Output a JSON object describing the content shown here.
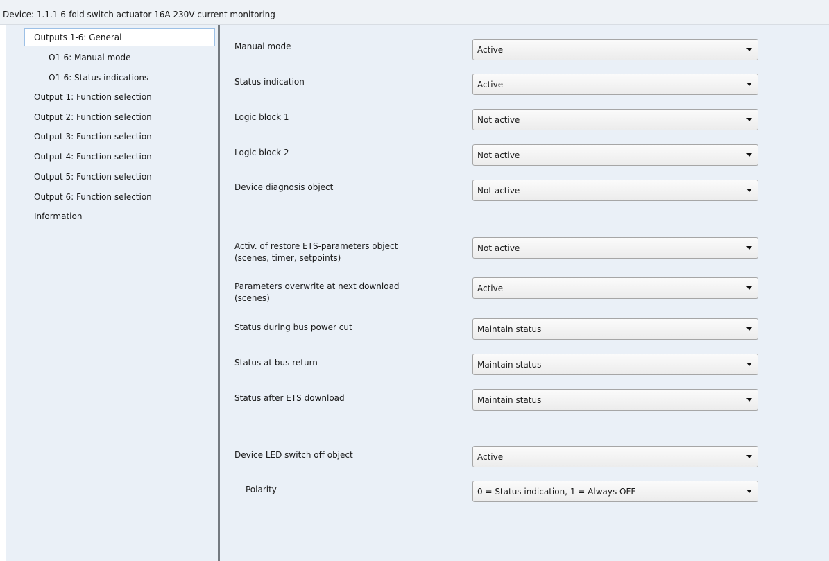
{
  "device_title": "Device: 1.1.1  6-fold switch actuator 16A 230V current monitoring",
  "sidebar": {
    "items": [
      {
        "label": "Outputs 1-6: General",
        "selected": true
      },
      {
        "label": "- O1-6: Manual mode"
      },
      {
        "label": "- O1-6: Status indications"
      },
      {
        "label": "Output 1: Function selection"
      },
      {
        "label": "Output 2: Function selection"
      },
      {
        "label": "Output 3: Function selection"
      },
      {
        "label": "Output 4: Function selection"
      },
      {
        "label": "Output 5: Function selection"
      },
      {
        "label": "Output 6: Function selection"
      },
      {
        "label": "Information"
      }
    ]
  },
  "parameters": [
    {
      "label": "Manual mode",
      "value": "Active"
    },
    {
      "label": "Status indication",
      "value": "Active"
    },
    {
      "label": "Logic block 1",
      "value": "Not active"
    },
    {
      "label": "Logic block 2",
      "value": "Not active"
    },
    {
      "label": "Device diagnosis object",
      "value": "Not active"
    },
    {
      "label": "Activ. of restore ETS-parameters object",
      "label2": "(scenes, timer, setpoints)",
      "value": "Not active"
    },
    {
      "label": "Parameters overwrite at next download",
      "label2": "(scenes)",
      "value": "Active"
    },
    {
      "label": "Status during bus power cut",
      "value": "Maintain status"
    },
    {
      "label": "Status at bus return",
      "value": "Maintain status"
    },
    {
      "label": "Status after ETS download",
      "value": "Maintain status"
    },
    {
      "label": "Device LED switch off object",
      "value": "Active"
    },
    {
      "label": "Polarity",
      "value": "0 = Status indication, 1 = Always OFF"
    }
  ]
}
